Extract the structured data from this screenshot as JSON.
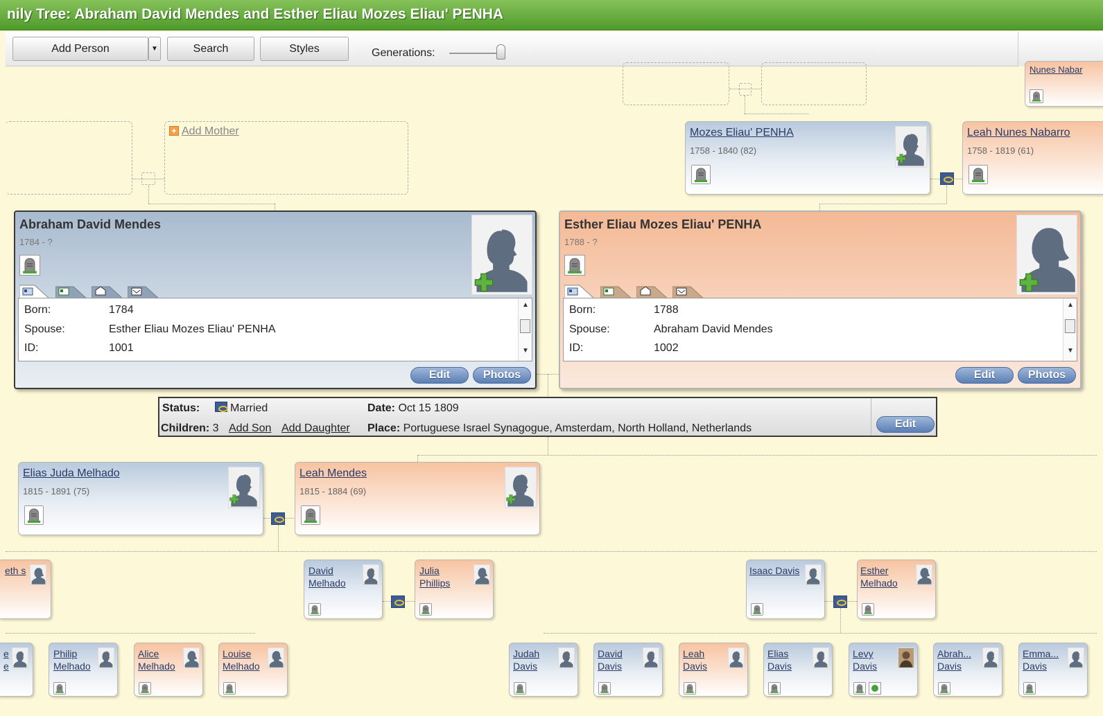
{
  "window": {
    "title": "nily Tree: Abraham David Mendes and Esther Eliau Mozes Eliau' PENHA"
  },
  "toolbar": {
    "add_person": "Add Person",
    "dropdown_arrow": "▼",
    "search": "Search",
    "styles": "Styles",
    "generations_label": "Generations:"
  },
  "tree": {
    "add_mother": "Add Mother",
    "add_icon": "+",
    "top_right_name": "Nunes Nabar",
    "paternal_grandfather": {
      "name": "Mozes Eliau' PENHA",
      "dates": "1758 - 1840 (82)"
    },
    "paternal_grandmother": {
      "name": "Leah Nunes Nabarro",
      "dates": "1758 - 1819 (61)"
    }
  },
  "focus": {
    "husband": {
      "name": "Abraham David Mendes",
      "dates": "1784 - ?",
      "born_label": "Born:",
      "born": "1784",
      "spouse_label": "Spouse:",
      "spouse": "Esther Eliau Mozes Eliau' PENHA",
      "id_label": "ID:",
      "id": "1001"
    },
    "wife": {
      "name": "Esther Eliau Mozes Eliau' PENHA",
      "dates": "1788 - ?",
      "born_label": "Born:",
      "born": "1788",
      "spouse_label": "Spouse:",
      "spouse": "Abraham David Mendes",
      "id_label": "ID:",
      "id": "1002"
    },
    "edit": "Edit",
    "photos": "Photos"
  },
  "marriage": {
    "status_label": "Status:",
    "status": "Married",
    "children_label": "Children:",
    "children": "3",
    "add_son": "Add Son",
    "add_daughter": "Add Daughter",
    "date_label": "Date:",
    "date": "Oct 15 1809",
    "place_label": "Place:",
    "place": "Portuguese Israel Synagogue, Amsterdam, North Holland, Netherlands",
    "edit": "Edit"
  },
  "children": {
    "elias": {
      "name": "Elias Juda Melhado",
      "dates": "1815 - 1891 (75)"
    },
    "leah": {
      "name": "Leah Mendes",
      "dates": "1815 - 1884 (69)"
    }
  },
  "grandchildren": {
    "eth_partial": "eth\ns",
    "david_melhado": "David Melhado",
    "julia_phillips": "Julia Phillips",
    "isaac_davis": "Isaac Davis",
    "esther_melhado": "Esther Melhado"
  },
  "great_grandchildren": {
    "partial": "e\ne",
    "philip": "Philip Melhado",
    "alice": "Alice Melhado",
    "louise": "Louise Melhado",
    "judah": "Judah Davis",
    "david": "David Davis",
    "leah": "Leah Davis",
    "elias": "Elias Davis",
    "levy": "Levy Davis",
    "abrah": "Abrah... Davis",
    "emma": "Emma... Davis"
  },
  "colors": {
    "title_green": "#5aa634",
    "male": "#b9cadd",
    "female": "#f7c3a1",
    "link": "#2a3a66",
    "background": "#fdf8d8"
  }
}
